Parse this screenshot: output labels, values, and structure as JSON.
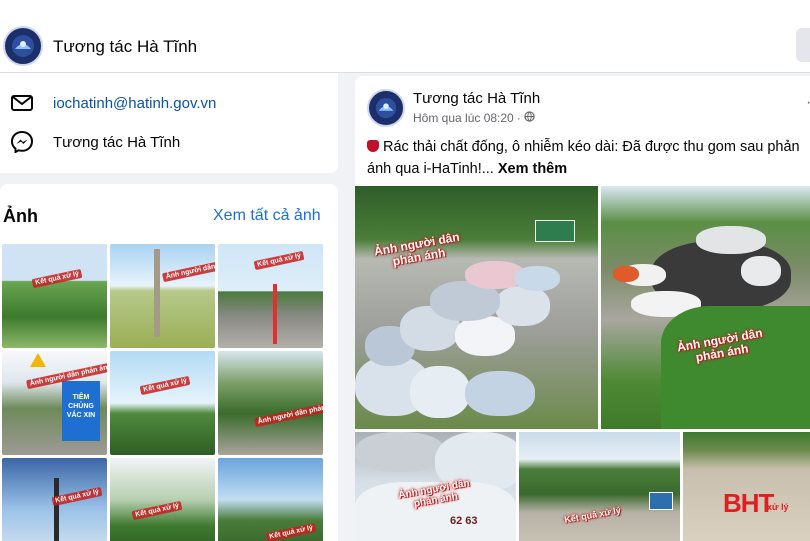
{
  "page": {
    "title": "Tương tác Hà Tĩnh"
  },
  "intro": {
    "email": "iochatinh@hatinh.gov.vn",
    "messenger": "Tương tác Hà Tĩnh"
  },
  "photos": {
    "heading": "Ảnh",
    "see_all": "Xem tất cả ảnh",
    "captions": [
      "Kết quả xử lý",
      "Ảnh người dân phản ánh",
      "Kết quả xử lý",
      "Ảnh người dân phản ánh",
      "Kết quả xử lý",
      "Ảnh người dân phản ánh",
      "Kết quả xử lý",
      "Kết quả xử lý",
      "Kết quả xử lý"
    ],
    "sign_text": "TIÊM CHỦNG VẮC XIN"
  },
  "post": {
    "author": "Tương tác Hà Tĩnh",
    "time": "Hôm qua lúc 08:20",
    "dot": "·",
    "text": "Rác thải chất đống, ô nhiễm kéo dài: Đã được thu gom sau phản ánh qua i-HaTinh!...",
    "see_more": "Xem thêm",
    "more": "···",
    "images": {
      "img1_caption": "Ảnh người dân phản ánh",
      "img2_caption": "Ảnh người dân phản ánh",
      "img3_caption": "Ảnh người dân phản ánh",
      "img4_caption": "Kết quả xử lý",
      "img5_logo": "BHT",
      "img5_caption": "xử lý",
      "bag_numbers": "62 63"
    }
  },
  "icons": {
    "email": "mail-icon",
    "messenger": "messenger-icon",
    "globe": "globe-icon",
    "pin": "pin-icon"
  }
}
